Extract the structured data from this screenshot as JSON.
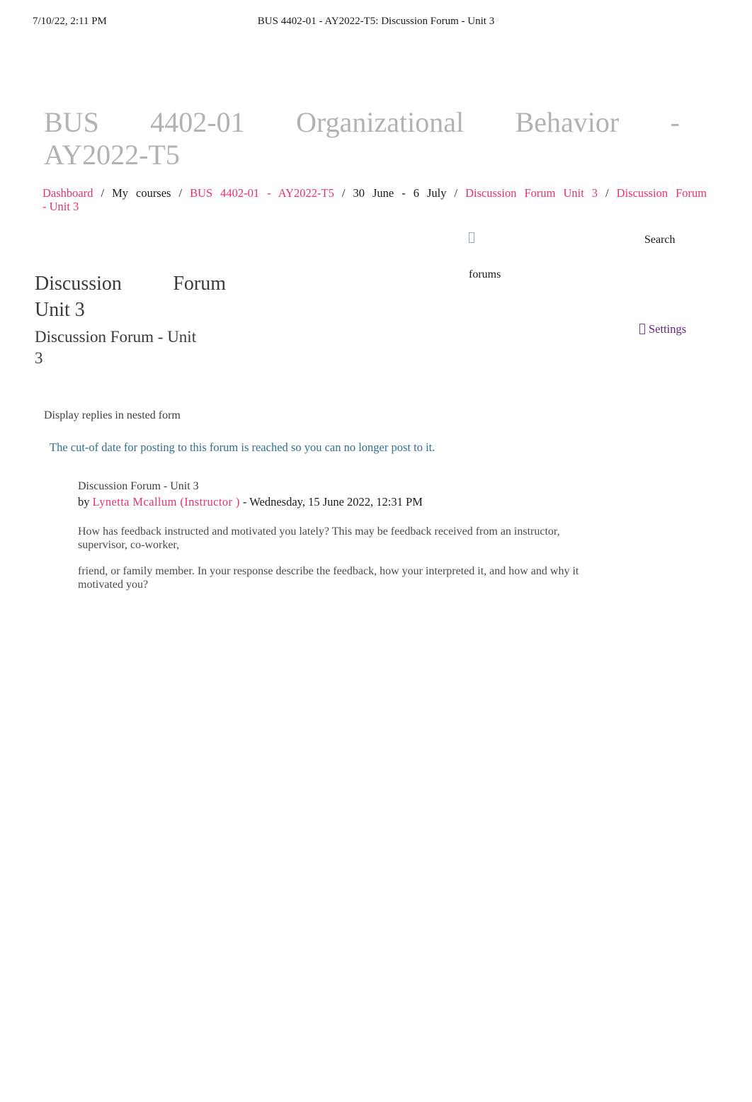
{
  "print_header": {
    "date": "7/10/22, 2:11 PM",
    "title": "BUS 4402-01 - AY2022-T5: Discussion Forum - Unit 3"
  },
  "course": {
    "title_line1": "BUS 4402-01 Organizational Behavior -",
    "title_line2": "AY2022-T5"
  },
  "breadcrumb": {
    "items": [
      {
        "label": "Dashboard",
        "type": "link"
      },
      {
        "label": "My courses",
        "type": "plain"
      },
      {
        "label": "BUS 4402-01 - AY2022-T5",
        "type": "link"
      },
      {
        "label": "30 June - 6 July",
        "type": "plain"
      },
      {
        "label": "Discussion Forum Unit 3",
        "type": "link"
      },
      {
        "label": "Discussion Forum",
        "type": "link"
      }
    ],
    "tail": "- Unit 3",
    "separator": "/"
  },
  "search": {
    "icon": "search-icon-missing-glyph",
    "label": "forums",
    "button_label": "Search"
  },
  "page": {
    "title_line1": "Discussion Forum",
    "title_line2": "Unit 3",
    "subtitle": "Discussion Forum - Unit 3"
  },
  "settings": {
    "icon": "gear-icon-missing-glyph",
    "label": "Settings"
  },
  "display_mode": {
    "label": "Display replies in nested form"
  },
  "alert": {
    "message": "The cut-of date for posting to this forum is reached so you can no longer post to it."
  },
  "post": {
    "subject": "Discussion Forum - Unit 3",
    "by_word": "by",
    "author": "Lynetta Mcallum (Instructor )",
    "timestamp": "- Wednesday, 15 June 2022, 12:31 PM",
    "paragraphs": [
      "How has feedback instructed and motivated you lately? This may be feedback received from an instructor, supervisor, co-worker,",
      "friend, or family member. In your response describe the feedback, how your interpreted it, and how and why it motivated you?"
    ]
  },
  "colors": {
    "link_pink": "#e6326e",
    "title_gray": "#b2b2b2",
    "alert_blue": "#31708f",
    "settings_purple": "#60267a",
    "body_text": "#4a4a4a"
  }
}
